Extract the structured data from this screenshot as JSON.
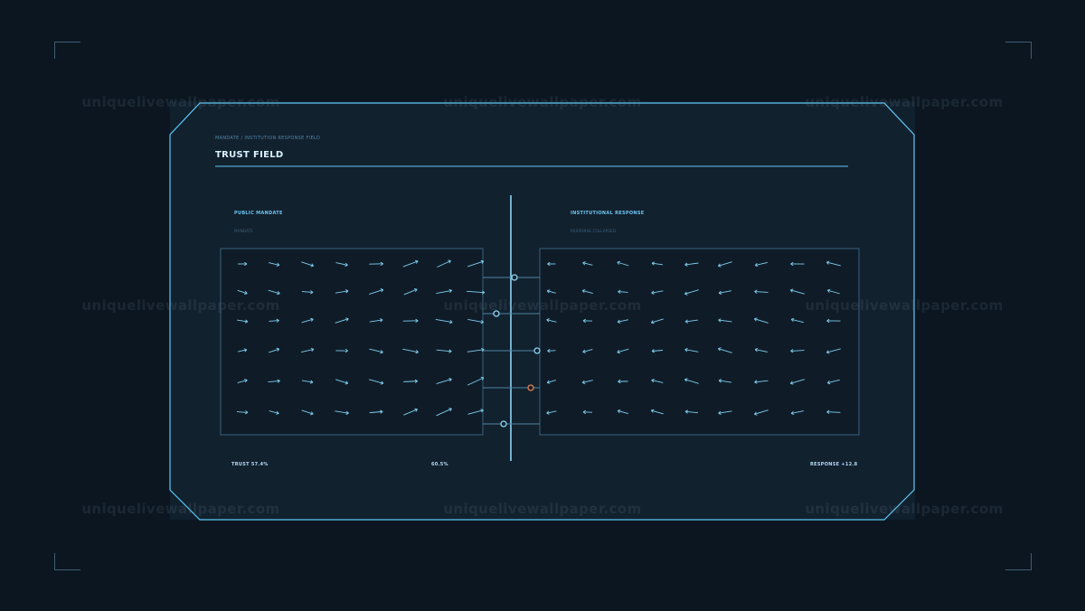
{
  "header": {
    "breadcrumb": "MANDATE / INSTITUTION RESPONSE FIELD",
    "title": "TRUST FIELD"
  },
  "left_panel": {
    "label": "PUBLIC MANDATE",
    "sublabel": "MANDATE"
  },
  "right_panel": {
    "label": "INSTITUTIONAL RESPONSE",
    "sublabel": "RESPONSE COLLAPSED"
  },
  "footer": {
    "trust": "TRUST 57.4%",
    "center": "60.5%",
    "response": "RESPONSE +12.8"
  },
  "watermark": "uniquelivewallpaper.com",
  "colors": {
    "background": "#0b1620",
    "panel": "#11202d",
    "frame": "#5cc8f5",
    "arrow": "#7fcdf0",
    "marker": "#8fd4f5",
    "alert_marker": "#e2814f"
  },
  "connector_markers": [
    {
      "status": "normal"
    },
    {
      "status": "normal"
    },
    {
      "status": "normal"
    },
    {
      "status": "alert"
    },
    {
      "status": "normal"
    }
  ]
}
